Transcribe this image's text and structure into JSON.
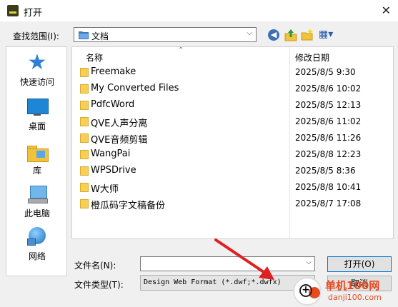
{
  "window": {
    "title": "打开",
    "close_glyph": "✕"
  },
  "lookin": {
    "label": "查找范围(I):",
    "value": "文档"
  },
  "toolbar": {
    "back_glyph": "◀",
    "view_glyph": "▦▾"
  },
  "places": [
    {
      "label": "快速访问"
    },
    {
      "label": "桌面"
    },
    {
      "label": "库"
    },
    {
      "label": "此电脑"
    },
    {
      "label": "网络"
    }
  ],
  "filelist": {
    "columns": {
      "name": "名称",
      "date": "修改日期"
    },
    "rows": [
      {
        "name": "Freemake",
        "date": "2025/8/5 9:30"
      },
      {
        "name": "My Converted Files",
        "date": "2025/8/6 10:02"
      },
      {
        "name": "PdfcWord",
        "date": "2025/8/5 12:13"
      },
      {
        "name": "QVE人声分离",
        "date": "2025/8/6 11:02"
      },
      {
        "name": "QVE音频剪辑",
        "date": "2025/8/6 11:26"
      },
      {
        "name": "WangPai",
        "date": "2025/8/8 12:23"
      },
      {
        "name": "WPSDrive",
        "date": "2025/8/5 8:36"
      },
      {
        "name": "W大师",
        "date": "2025/8/8 10:41"
      },
      {
        "name": "橙瓜码字文稿备份",
        "date": "2025/8/7 17:08"
      }
    ]
  },
  "filename": {
    "label": "文件名(N):",
    "value": "",
    "placeholder": ""
  },
  "filetype": {
    "label": "文件类型(T):",
    "value": "Design Web Format (*.dwf;*.dwfx)"
  },
  "buttons": {
    "open": "打开(O)",
    "cancel": "取消"
  },
  "watermark": {
    "line1": "单机100网",
    "line2": "danji100.com"
  },
  "colors": {
    "accent": "#0078d7",
    "folder": "#f7cf56",
    "arrow": "#e02020",
    "watermark": "#e64b1f"
  }
}
